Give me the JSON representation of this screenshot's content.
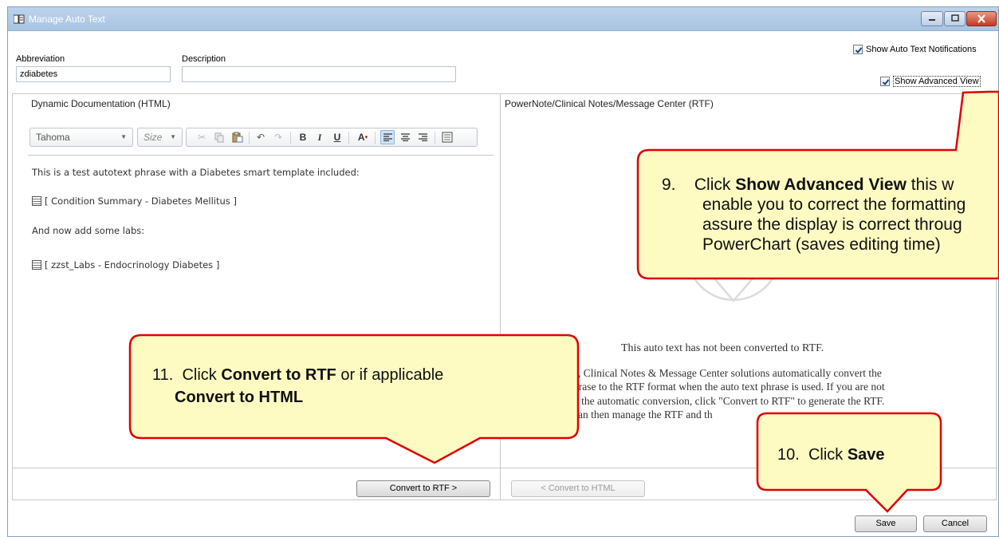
{
  "window": {
    "title": "Manage Auto Text"
  },
  "form": {
    "abbreviation_label": "Abbreviation",
    "abbreviation_value": "zdiabetes",
    "description_label": "Description",
    "description_value": ""
  },
  "options": {
    "show_notifications_label": "Show Auto Text Notifications",
    "show_notifications_checked": true,
    "show_advanced_label": "Show Advanced View",
    "show_advanced_checked": true
  },
  "html_panel": {
    "title": "Dynamic Documentation (HTML)",
    "font_value": "Tahoma",
    "size_placeholder": "Size",
    "lines": [
      "This is a test autotext phrase with a Diabetes smart template included:",
      "[ Condition Summary - Diabetes Mellitus ]",
      "And now add some labs:",
      "[ zzst_Labs - Endocrinology Diabetes ]"
    ],
    "convert_button": "Convert to RTF >"
  },
  "rtf_panel": {
    "title": "PowerNote/Clinical Notes/Message Center (RTF)",
    "message_title": "This auto text has not been converted to RTF.",
    "message_lines": [
      "e, Clinical Notes & Message Center solutions automatically convert the",
      "hrase to the RTF format when the auto text phrase is used. If you are not",
      "h the automatic conversion, click \"Convert to RTF\" to generate the RTF.",
      "can then manage the RTF and th"
    ],
    "convert_button": "< Convert to HTML"
  },
  "footer": {
    "save": "Save",
    "cancel": "Cancel"
  },
  "callouts": {
    "c9": {
      "num": "9.",
      "line1_pre": "Click ",
      "line1_bold": "Show Advanced View",
      "line1_post": " this w",
      "line2": "enable you to correct the formatting",
      "line3": "assure the display is correct throug",
      "line4": "PowerChart (saves editing time)"
    },
    "c11": {
      "num": "11.",
      "line1_pre": "Click ",
      "line1_bold": "Convert to RTF",
      "line1_post": " or if applicable",
      "line2_bold": "Convert to HTML"
    },
    "c10": {
      "num": "10.",
      "pre": "Click ",
      "bold": "Save"
    }
  },
  "colors": {
    "callout_fill": "#fdfbc2",
    "callout_border": "#e00000",
    "titlebar": "#b2cbe8"
  }
}
